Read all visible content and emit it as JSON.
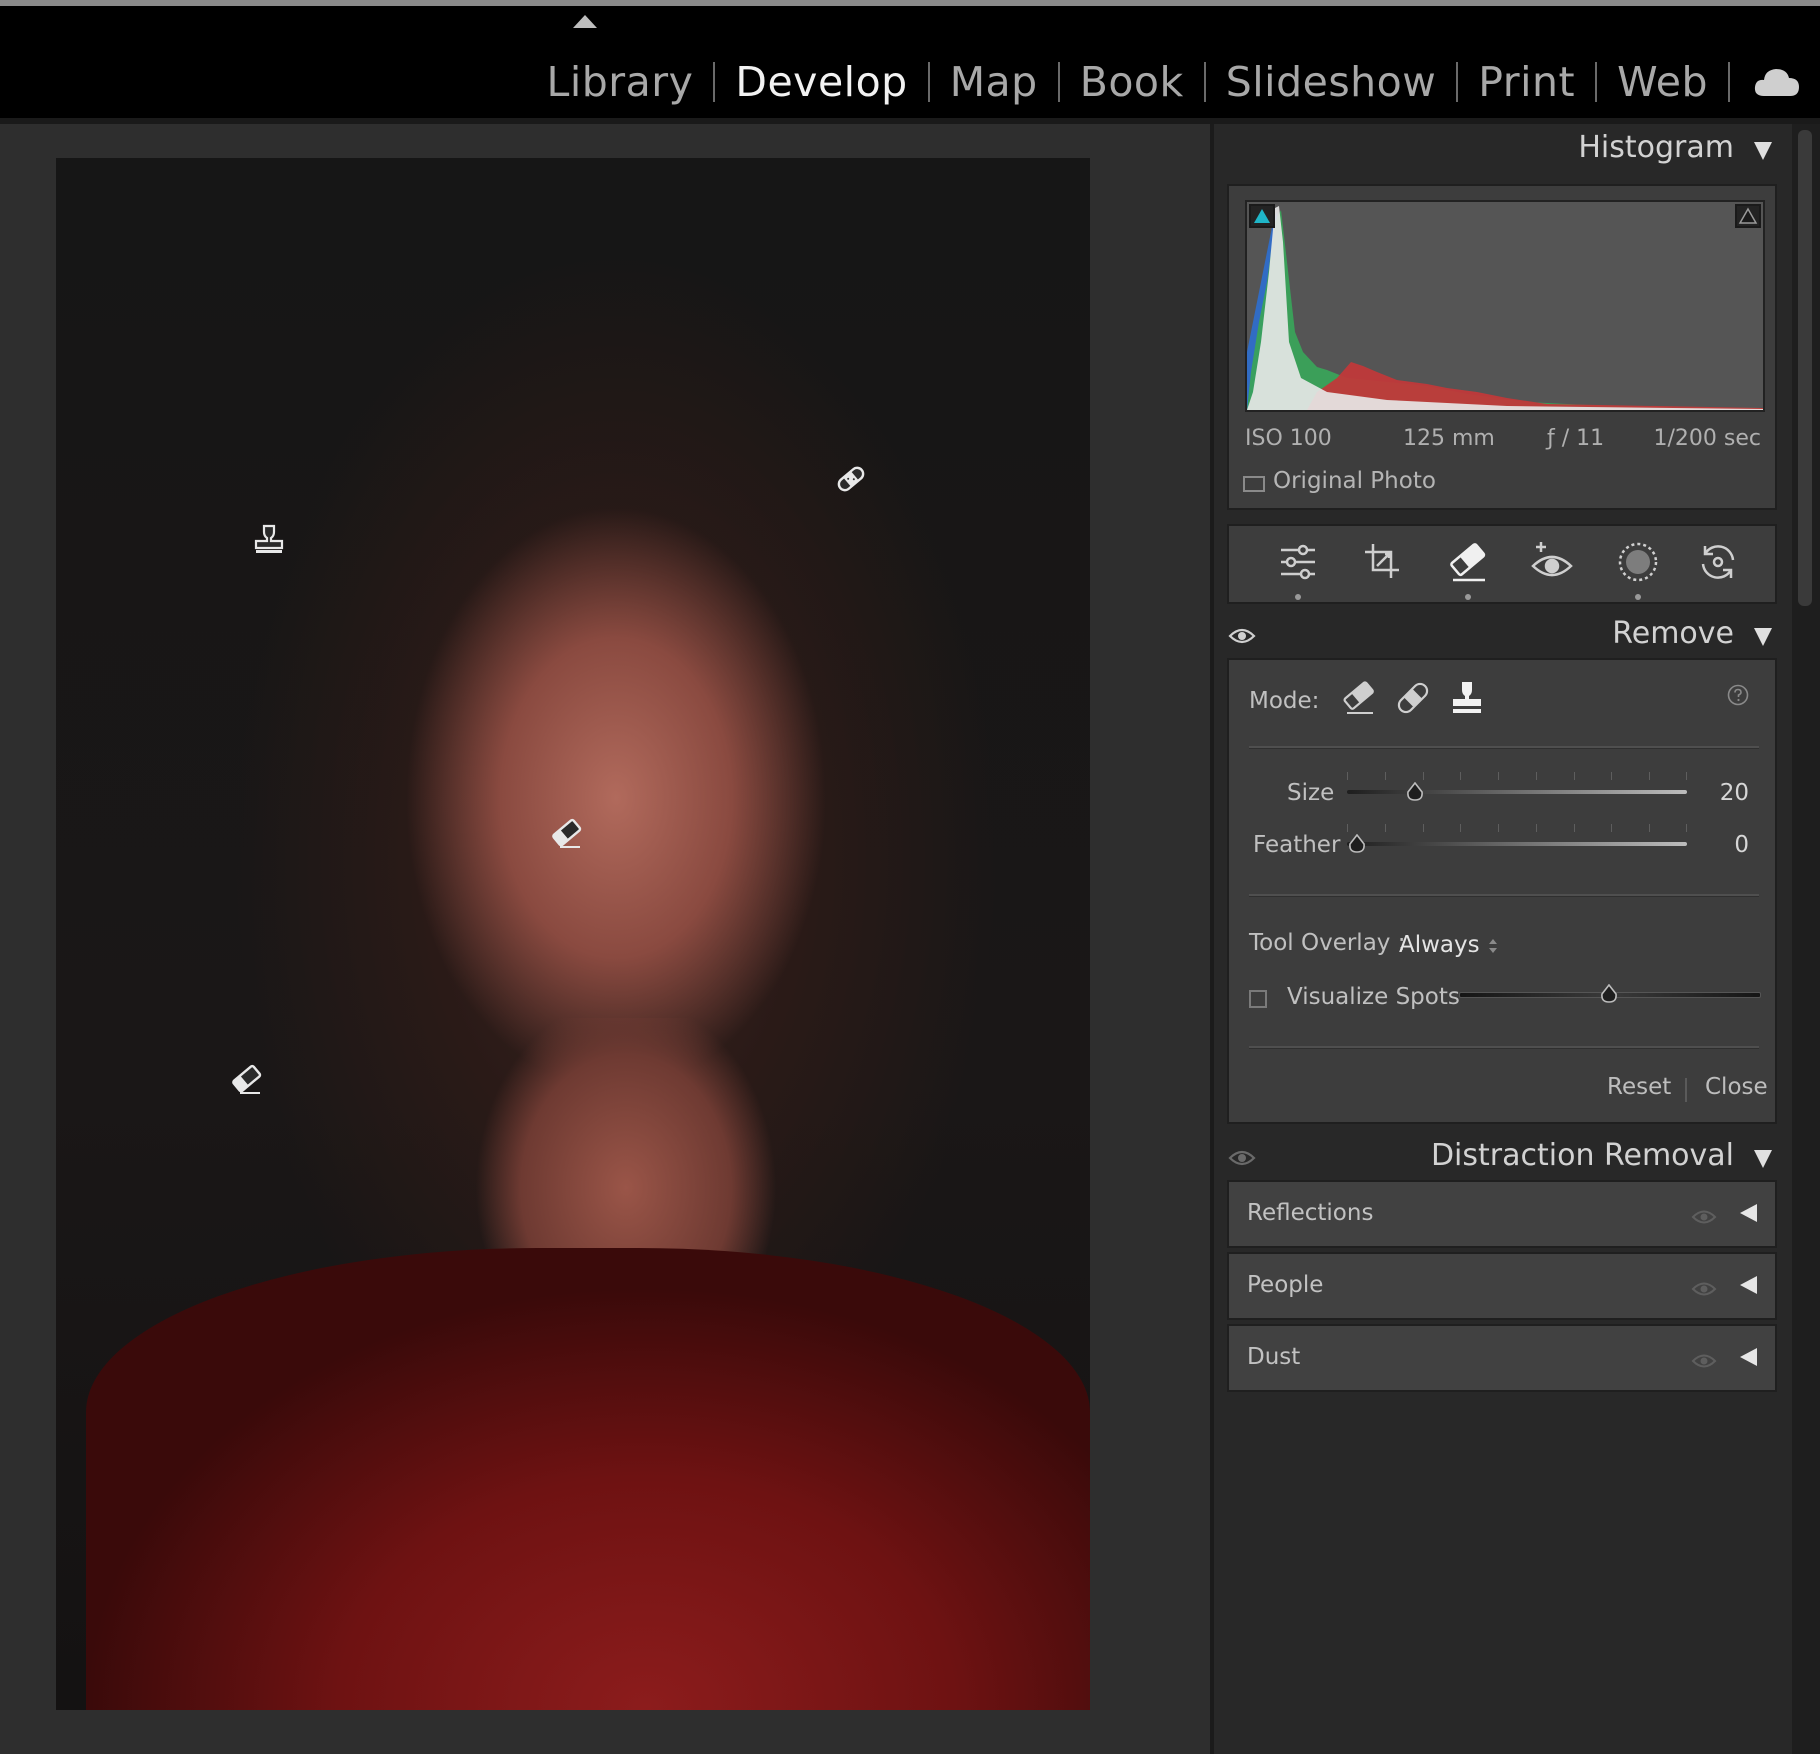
{
  "modules": {
    "items": [
      "Library",
      "Develop",
      "Map",
      "Book",
      "Slideshow",
      "Print",
      "Web"
    ],
    "active": "Develop"
  },
  "histogram": {
    "title": "Histogram",
    "iso": "ISO 100",
    "focal": "125 mm",
    "aperture": "ƒ / 11",
    "shutter": "1/200 sec",
    "original_photo_label": "Original Photo",
    "shadow_clip_color": "#1fb6c8"
  },
  "tools": [
    "edit-sliders-icon",
    "crop-icon",
    "remove-eraser-icon",
    "red-eye-icon",
    "masking-icon",
    "reset-icon"
  ],
  "remove": {
    "title": "Remove",
    "mode_label": "Mode:",
    "size_label": "Size",
    "size_value": "20",
    "size_fraction": 0.2,
    "feather_label": "Feather",
    "feather_value": "0",
    "feather_fraction": 0.0,
    "tool_overlay_label": "Tool Overlay :",
    "tool_overlay_value": "Always",
    "visualize_label": "Visualize Spots",
    "visualize_fraction": 0.5,
    "reset_label": "Reset",
    "close_label": "Close"
  },
  "distraction": {
    "title": "Distraction Removal",
    "items": [
      "Reflections",
      "People",
      "Dust"
    ]
  }
}
